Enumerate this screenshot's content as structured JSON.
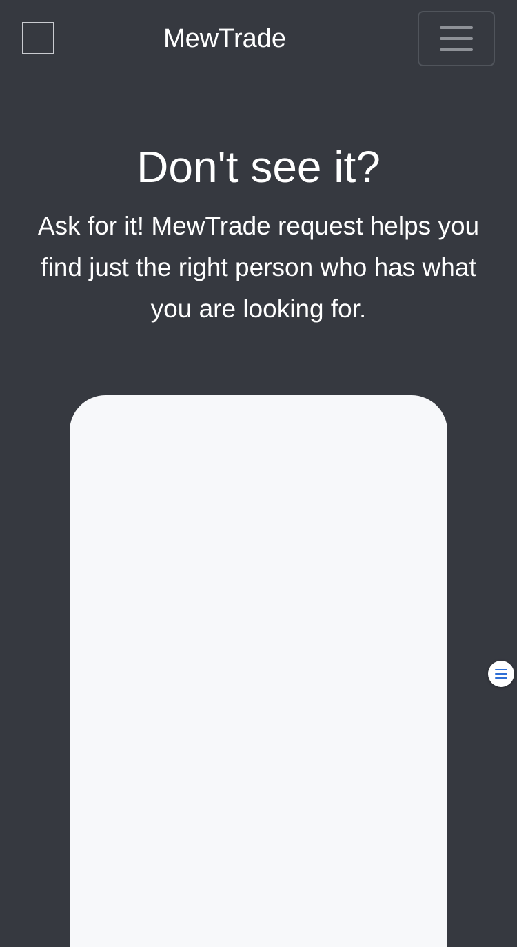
{
  "header": {
    "brand": "MewTrade",
    "logo_icon": "logo-placeholder-icon",
    "menu_icon": "hamburger-menu-icon"
  },
  "hero": {
    "title": "Don't see it?",
    "text": "Ask for it! MewTrade request helps you find just the right person who has what you are looking for."
  },
  "phone_mockup": {
    "image_icon": "image-placeholder-icon"
  },
  "floating_button": {
    "icon": "list-icon",
    "color": "#2f6fd6"
  },
  "colors": {
    "background": "#363940",
    "card": "#f7f8fa",
    "text": "#ffffff"
  }
}
